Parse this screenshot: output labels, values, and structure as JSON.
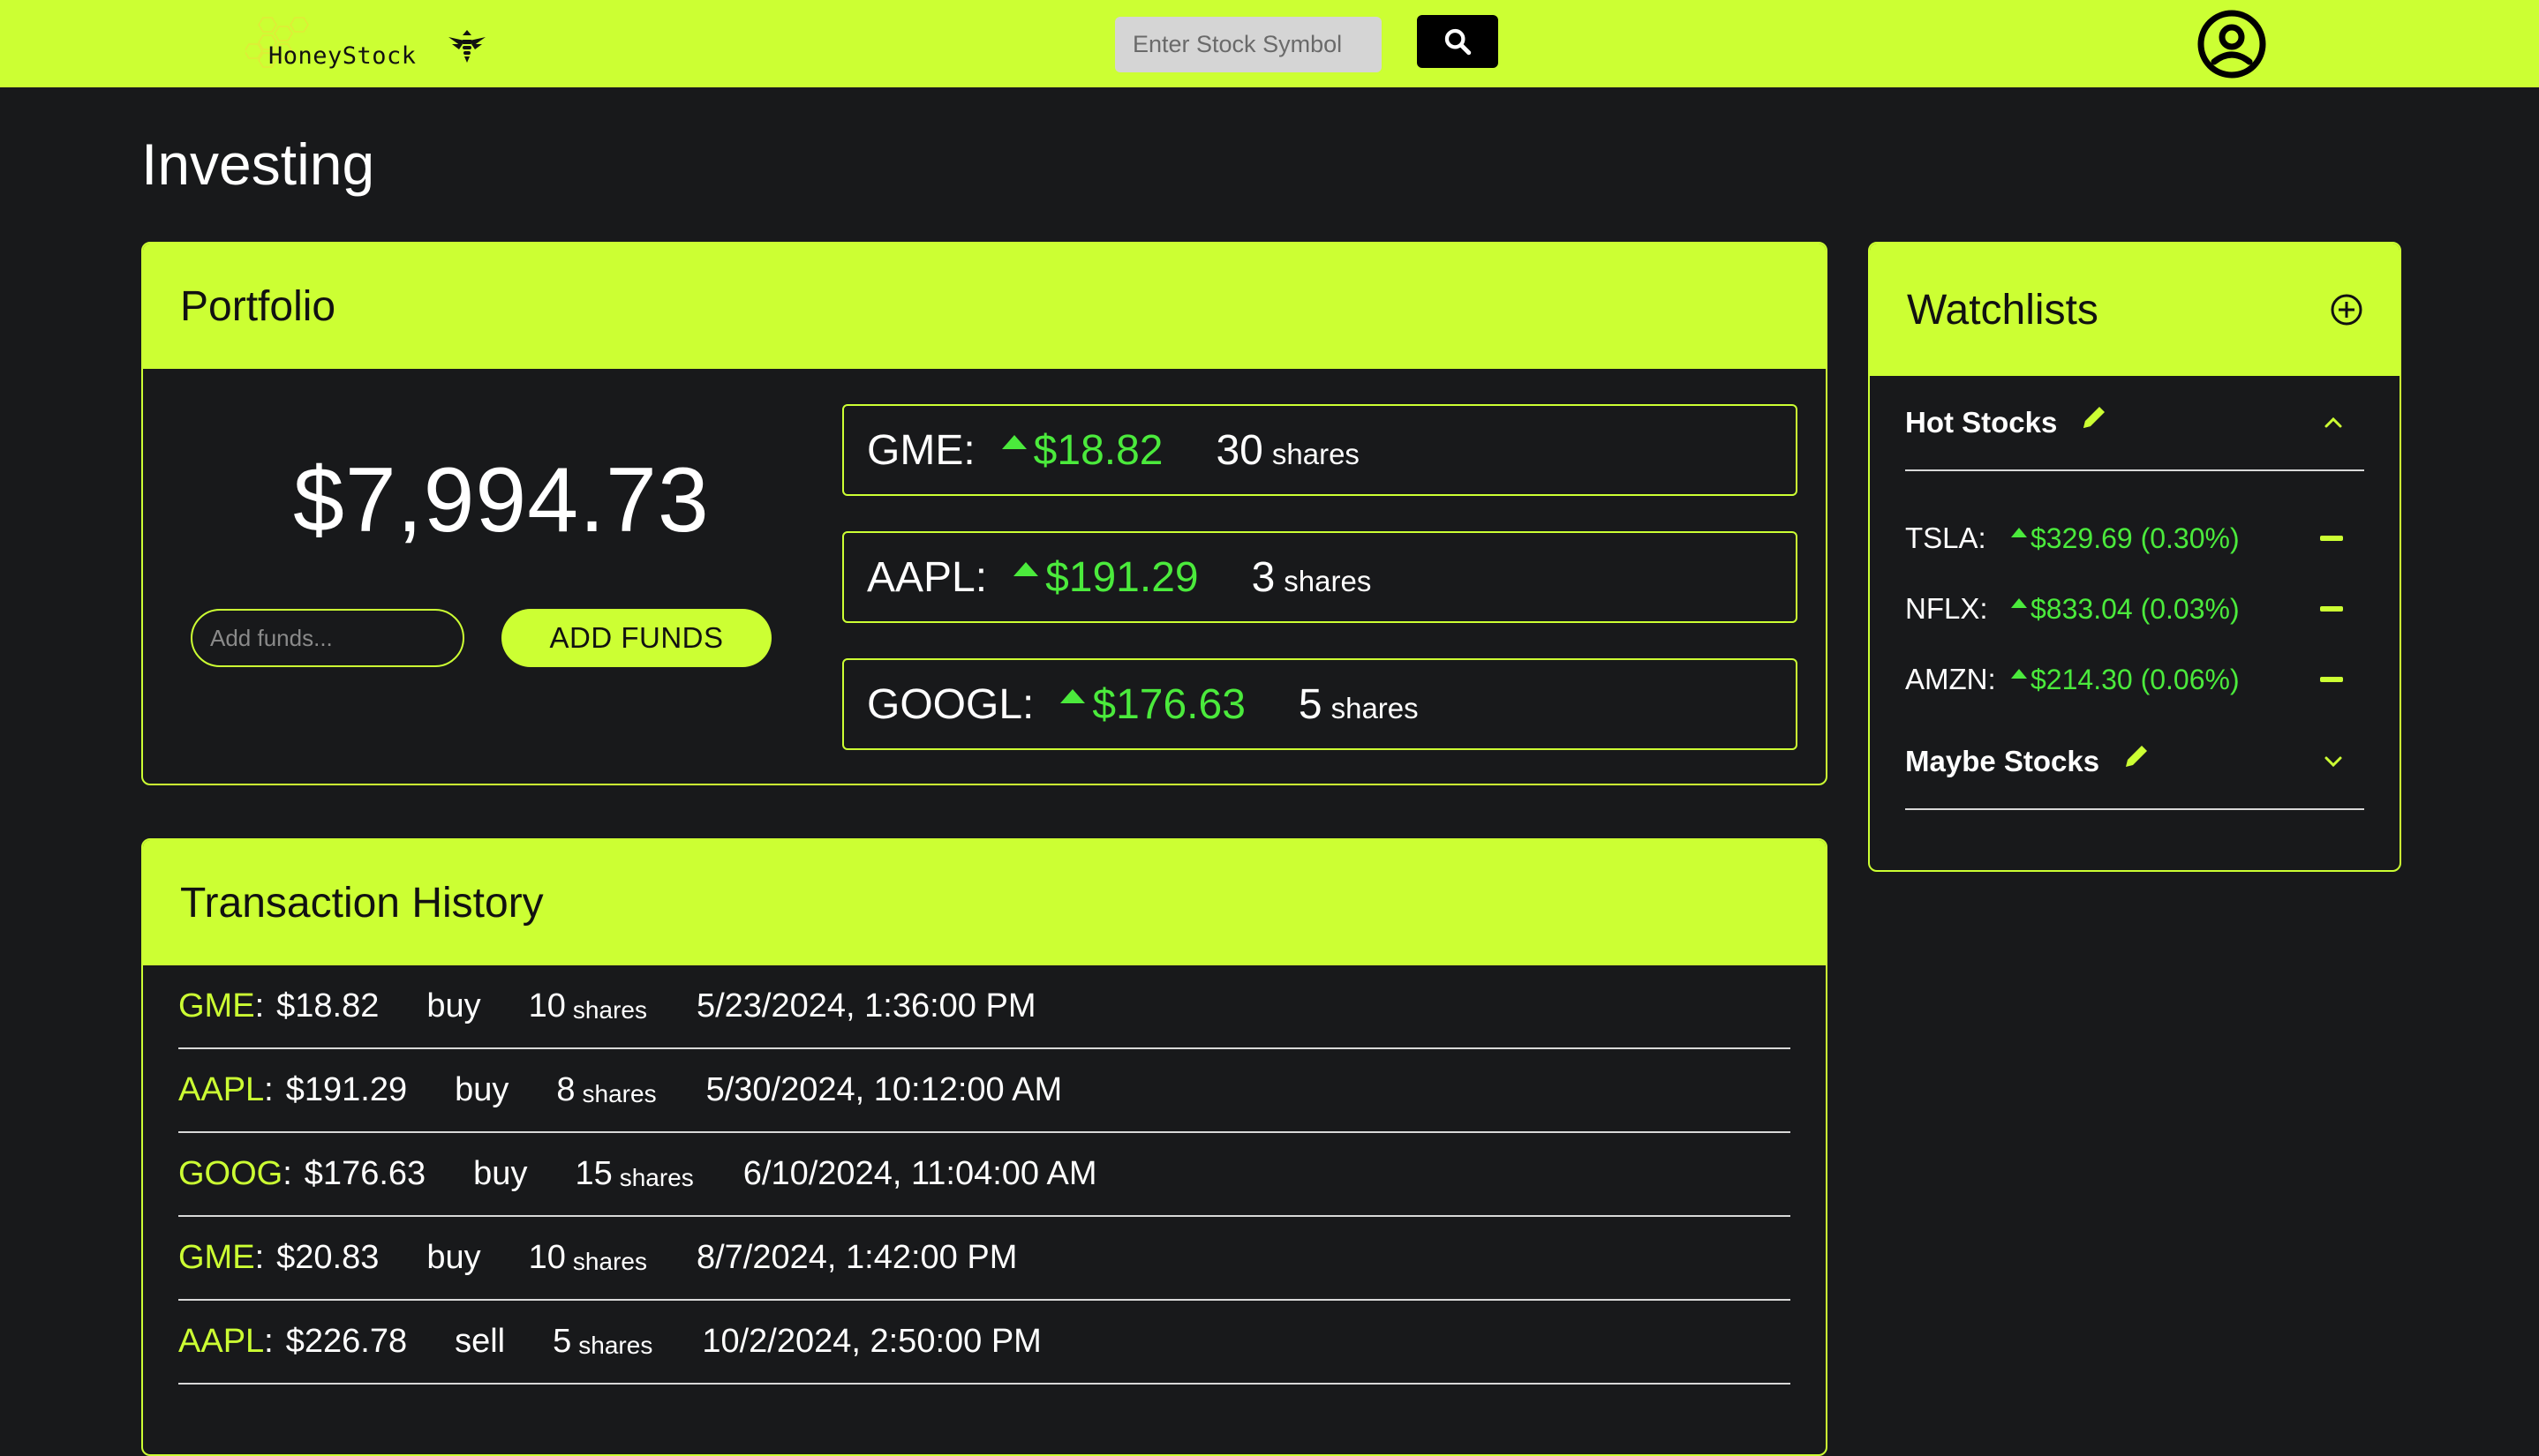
{
  "nav": {
    "logo_text": "HoneyStock",
    "search_placeholder": "Enter Stock Symbol",
    "icons": {
      "bee": "bee-icon",
      "search": "search-icon",
      "account": "account-circle-icon"
    }
  },
  "page_title": "Investing",
  "portfolio": {
    "title": "Portfolio",
    "balance": "$7,994.73",
    "funds_placeholder": "Add funds...",
    "add_funds_label": "ADD FUNDS",
    "holdings": [
      {
        "symbol": "GME:",
        "price": "$18.82",
        "quantity": "30",
        "unit": "shares",
        "trend": "up"
      },
      {
        "symbol": "AAPL:",
        "price": "$191.29",
        "quantity": "3",
        "unit": "shares",
        "trend": "up"
      },
      {
        "symbol": "GOOGL:",
        "price": "$176.63",
        "quantity": "5",
        "unit": "shares",
        "trend": "up"
      }
    ]
  },
  "transaction_history": {
    "title": "Transaction History",
    "rows": [
      {
        "symbol": "GME",
        "price": "$18.82",
        "type": "buy",
        "quantity": "10",
        "unit": "shares",
        "date": "5/23/2024, 1:36:00 PM"
      },
      {
        "symbol": "AAPL",
        "price": "$191.29",
        "type": "buy",
        "quantity": "8",
        "unit": "shares",
        "date": "5/30/2024, 10:12:00 AM"
      },
      {
        "symbol": "GOOG",
        "price": "$176.63",
        "type": "buy",
        "quantity": "15",
        "unit": "shares",
        "date": "6/10/2024, 11:04:00 AM"
      },
      {
        "symbol": "GME",
        "price": "$20.83",
        "type": "buy",
        "quantity": "10",
        "unit": "shares",
        "date": "8/7/2024, 1:42:00 PM"
      },
      {
        "symbol": "AAPL",
        "price": "$226.78",
        "type": "sell",
        "quantity": "5",
        "unit": "shares",
        "date": "10/2/2024, 2:50:00 PM"
      }
    ]
  },
  "watchlists": {
    "title": "Watchlists",
    "lists": [
      {
        "name": "Hot Stocks",
        "expanded": true,
        "items": [
          {
            "symbol": "TSLA:",
            "price": "$329.69 (0.30%)",
            "trend": "up"
          },
          {
            "symbol": "NFLX:",
            "price": "$833.04 (0.03%)",
            "trend": "up"
          },
          {
            "symbol": "AMZN:",
            "price": "$214.30 (0.06%)",
            "trend": "up"
          }
        ]
      },
      {
        "name": "Maybe Stocks",
        "expanded": false,
        "items": []
      }
    ]
  },
  "colors": {
    "accent": "#ccff33",
    "background": "#18191b",
    "gain": "#4bea3c"
  }
}
